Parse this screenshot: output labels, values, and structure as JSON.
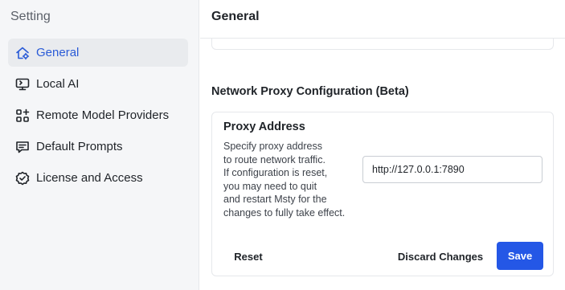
{
  "sidebar": {
    "title": "Setting",
    "items": [
      {
        "label": "General",
        "icon": "home-gear-icon",
        "active": true
      },
      {
        "label": "Local AI",
        "icon": "monitor-icon",
        "active": false
      },
      {
        "label": "Remote Model Providers",
        "icon": "grid-plus-icon",
        "active": false
      },
      {
        "label": "Default Prompts",
        "icon": "message-text-icon",
        "active": false
      },
      {
        "label": "License and Access",
        "icon": "badge-check-icon",
        "active": false
      }
    ]
  },
  "header": {
    "title": "General"
  },
  "proxy_section": {
    "title": "Network Proxy Configuration (Beta)",
    "card": {
      "title": "Proxy Address",
      "description": "Specify proxy address\nto route network traffic.\nIf configuration is reset,\nyou may need to quit\nand restart Msty for the\nchanges to fully take effect.",
      "input_value": "http://127.0.0.1:7890",
      "reset_label": "Reset",
      "discard_label": "Discard Changes",
      "save_label": "Save"
    }
  },
  "colors": {
    "accent": "#2457e6",
    "active_nav_text": "#2a5bd7",
    "sidebar_bg": "#f5f6f8"
  }
}
